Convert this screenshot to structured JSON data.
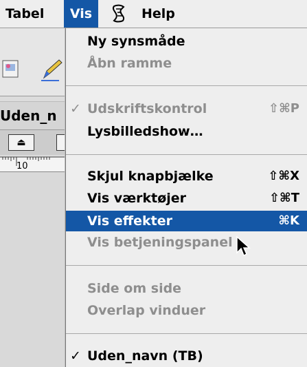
{
  "menubar": {
    "tabel": "Tabel",
    "vis": "Vis",
    "script_icon": "scroll-script-icon",
    "help": "Help"
  },
  "background_window": {
    "title": "Uden_n",
    "ruler_label": "10",
    "mini_button_icon": "eject-icon"
  },
  "menu": {
    "items": [
      {
        "label": "Ny synsmåde",
        "shortcut": "",
        "check": "",
        "state": "enabled"
      },
      {
        "label": "Åbn ramme",
        "shortcut": "",
        "check": "",
        "state": "disabled"
      },
      {
        "label": "Udskriftskontrol",
        "shortcut": "⇧⌘P",
        "check": "✓",
        "state": "disabled"
      },
      {
        "label": "Lysbilledshow…",
        "shortcut": "",
        "check": "",
        "state": "enabled"
      },
      {
        "label": "Skjul knapbjælke",
        "shortcut": "⇧⌘X",
        "check": "",
        "state": "enabled"
      },
      {
        "label": "Vis værktøjer",
        "shortcut": "⇧⌘T",
        "check": "",
        "state": "enabled"
      },
      {
        "label": "Vis effekter",
        "shortcut": "⌘K",
        "check": "",
        "state": "highlighted"
      },
      {
        "label": "Vis betjeningspanel",
        "shortcut": "",
        "check": "",
        "state": "disabled"
      },
      {
        "label": "Side om side",
        "shortcut": "",
        "check": "",
        "state": "disabled"
      },
      {
        "label": "Overlap vinduer",
        "shortcut": "",
        "check": "",
        "state": "disabled"
      },
      {
        "label": "Uden_navn (TB)",
        "shortcut": "",
        "check": "✓",
        "state": "enabled"
      }
    ]
  },
  "colors": {
    "highlight": "#1457a6",
    "menu_bg": "#eeeeee",
    "disabled_text": "#8e8e8e"
  }
}
